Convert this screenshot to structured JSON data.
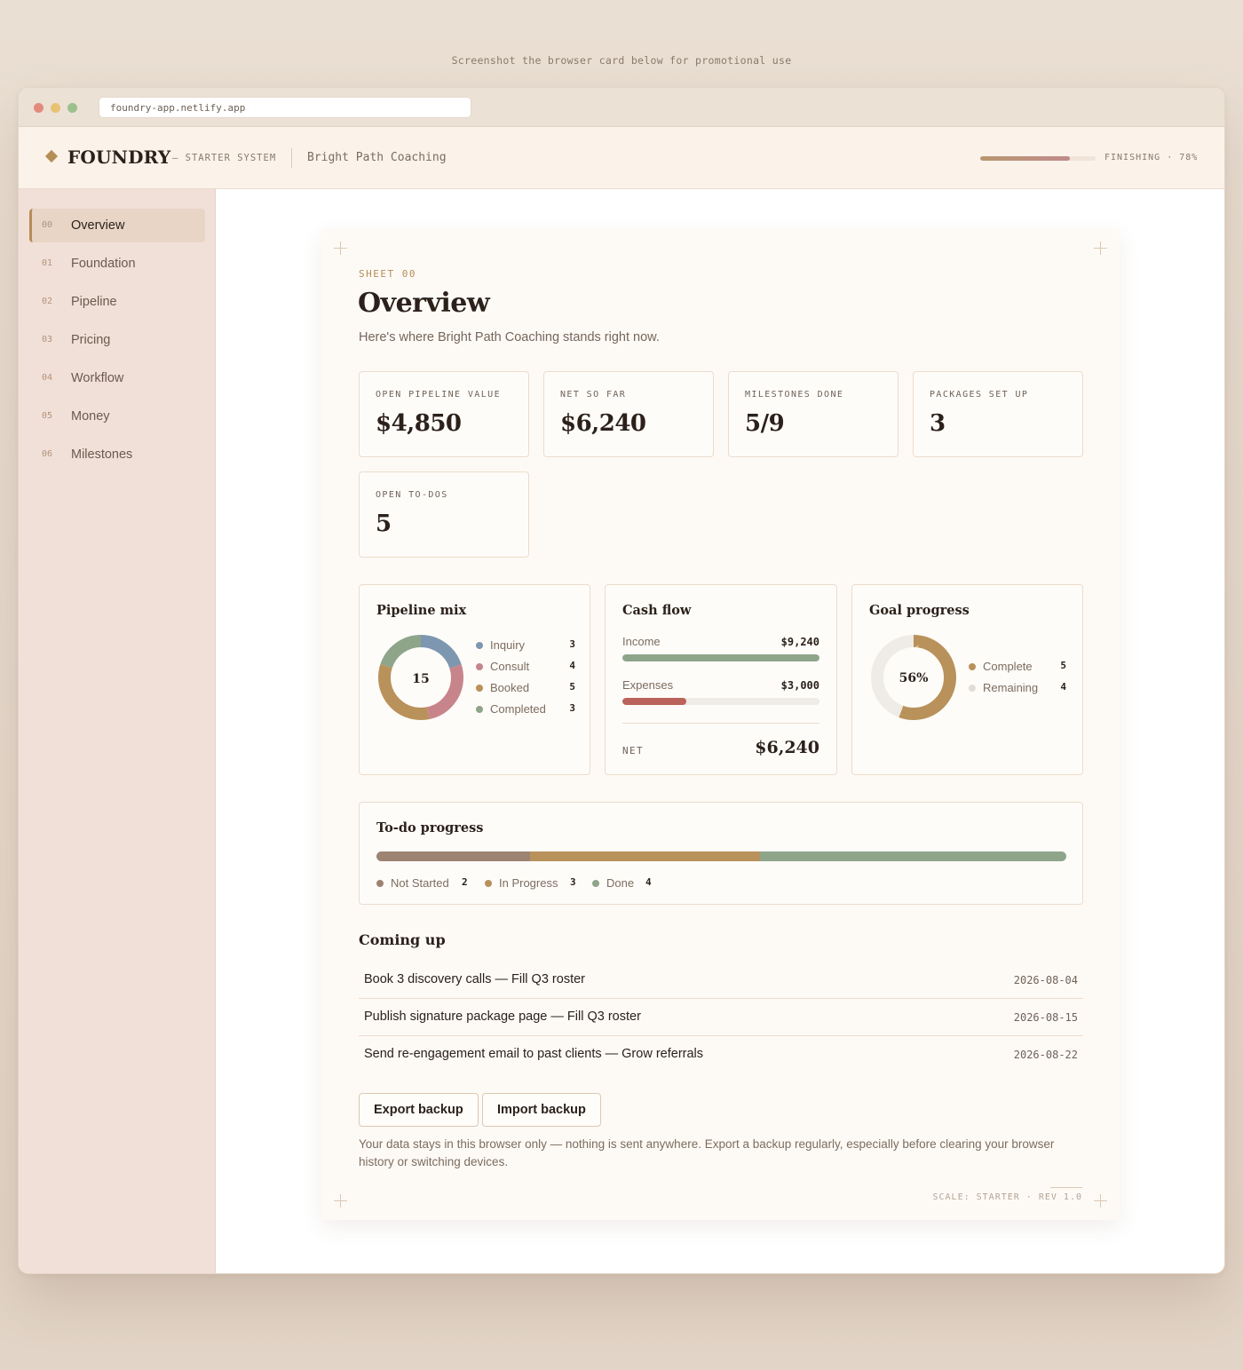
{
  "promo_text": "Screenshot the browser card below for promotional use",
  "browser": {
    "url": "foundry-app.netlify.app"
  },
  "header": {
    "brand": "FOUNDRY",
    "brand_sub": "— STARTER SYSTEM",
    "client": "Bright Path Coaching",
    "progress_label": "FINISHING · 78%",
    "progress_value": 0.78
  },
  "sidebar": {
    "items": [
      {
        "num": "00",
        "label": "Overview",
        "active": true
      },
      {
        "num": "01",
        "label": "Foundation"
      },
      {
        "num": "02",
        "label": "Pipeline"
      },
      {
        "num": "03",
        "label": "Pricing"
      },
      {
        "num": "04",
        "label": "Workflow"
      },
      {
        "num": "05",
        "label": "Money"
      },
      {
        "num": "06",
        "label": "Milestones"
      }
    ]
  },
  "sheet": {
    "num": "SHEET 00",
    "title": "Overview",
    "subtitle": "Here's where Bright Path Coaching stands right now.",
    "stats": [
      {
        "label": "OPEN PIPELINE VALUE",
        "value": "$4,850"
      },
      {
        "label": "NET SO FAR",
        "value": "$6,240"
      },
      {
        "label": "MILESTONES DONE",
        "value": "5/9"
      },
      {
        "label": "PACKAGES SET UP",
        "value": "3"
      },
      {
        "label": "OPEN TO-DOS",
        "value": "5"
      }
    ],
    "pipeline": {
      "title": "Pipeline mix",
      "total": "15",
      "items": [
        {
          "name": "Inquiry",
          "count": "3",
          "value": 3,
          "color": "#7e97b0"
        },
        {
          "name": "Consult",
          "count": "4",
          "value": 4,
          "color": "#c8848b"
        },
        {
          "name": "Booked",
          "count": "5",
          "value": 5,
          "color": "#b9915a"
        },
        {
          "name": "Completed",
          "count": "3",
          "value": 3,
          "color": "#8ea58a"
        }
      ]
    },
    "cashflow": {
      "title": "Cash flow",
      "income_label": "Income",
      "income_amount": "$9,240",
      "income_value": 9240,
      "expenses_label": "Expenses",
      "expenses_amount": "$3,000",
      "expenses_value": 3000,
      "net_label": "NET",
      "net_value": "$6,240",
      "income_color": "#8ea58a",
      "expenses_color": "#b9635a"
    },
    "goal": {
      "title": "Goal progress",
      "percent_label": "56%",
      "complete_label": "Complete",
      "complete_count": "5",
      "complete_value": 5,
      "remaining_label": "Remaining",
      "remaining_count": "4",
      "remaining_value": 4,
      "complete_color": "#b9915a",
      "remaining_color": "#efebe6"
    },
    "todo": {
      "title": "To-do progress",
      "items": [
        {
          "name": "Not Started",
          "count": "2",
          "value": 2,
          "color": "#9c8372"
        },
        {
          "name": "In Progress",
          "count": "3",
          "value": 3,
          "color": "#b9915a"
        },
        {
          "name": "Done",
          "count": "4",
          "value": 4,
          "color": "#8ea58a"
        }
      ]
    },
    "coming_up": {
      "title": "Coming up",
      "tasks": [
        {
          "text": "Book 3 discovery calls — Fill Q3 roster",
          "date": "2026-08-04"
        },
        {
          "text": "Publish signature package page — Fill Q3 roster",
          "date": "2026-08-15"
        },
        {
          "text": "Send re-engagement email to past clients — Grow referrals",
          "date": "2026-08-22"
        }
      ]
    },
    "buttons": {
      "export": "Export backup",
      "import": "Import backup"
    },
    "note": "Your data stays in this browser only — nothing is sent anywhere. Export a backup regularly, especially before clearing your browser history or switching devices.",
    "scale": "SCALE: STARTER · REV 1.0"
  }
}
